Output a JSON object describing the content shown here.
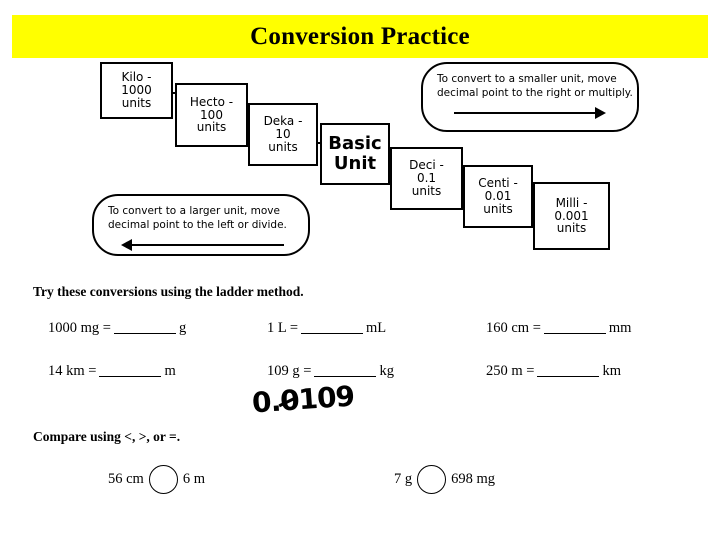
{
  "title": {
    "text": "Conversion Practice",
    "banner_color": "#ffff00",
    "text_color": "#000000"
  },
  "ladder": {
    "steps": [
      {
        "name": "kilo",
        "line1": "Kilo -",
        "line2": "1000",
        "line3": "units"
      },
      {
        "name": "hecto",
        "line1": "Hecto -",
        "line2": "100",
        "line3": "units"
      },
      {
        "name": "deka",
        "line1": "Deka -",
        "line2": "10",
        "line3": "units"
      },
      {
        "name": "basic",
        "line1": "Basic",
        "line2": "Unit",
        "line3": ""
      },
      {
        "name": "deci",
        "line1": "Deci -",
        "line2": "0.1",
        "line3": "units"
      },
      {
        "name": "centi",
        "line1": "Centi -",
        "line2": "0.01",
        "line3": "units"
      },
      {
        "name": "milli",
        "line1": "Milli -",
        "line2": "0.001",
        "line3": "units"
      }
    ]
  },
  "callouts": {
    "smaller": {
      "line1": "To convert to a smaller unit, move",
      "line2": "decimal  point to the right or multiply.",
      "arrow_direction": "right"
    },
    "larger": {
      "line1": "To convert to a larger unit, move",
      "line2": "decimal  point to the left or divide.",
      "arrow_direction": "left"
    }
  },
  "worksheet": {
    "instruction": "Try these conversions using the ladder method.",
    "problems": [
      {
        "prefix": "1000 mg =",
        "suffix": "g"
      },
      {
        "prefix": "1 L =",
        "suffix": "mL"
      },
      {
        "prefix": "160 cm =",
        "suffix": "mm"
      },
      {
        "prefix": "14 km =",
        "suffix": "m"
      },
      {
        "prefix": "109 g =",
        "suffix": "kg"
      },
      {
        "prefix": "250 m =",
        "suffix": "km"
      }
    ],
    "handwritten_answer": {
      "before": "0.",
      "struck": "0",
      "after": "109",
      "full": "0.0109"
    }
  },
  "compare": {
    "instruction": "Compare using <, >, or =.",
    "pairs": [
      {
        "left": "56 cm",
        "right": "6 m"
      },
      {
        "left": "7 g",
        "right": "698 mg"
      }
    ]
  }
}
